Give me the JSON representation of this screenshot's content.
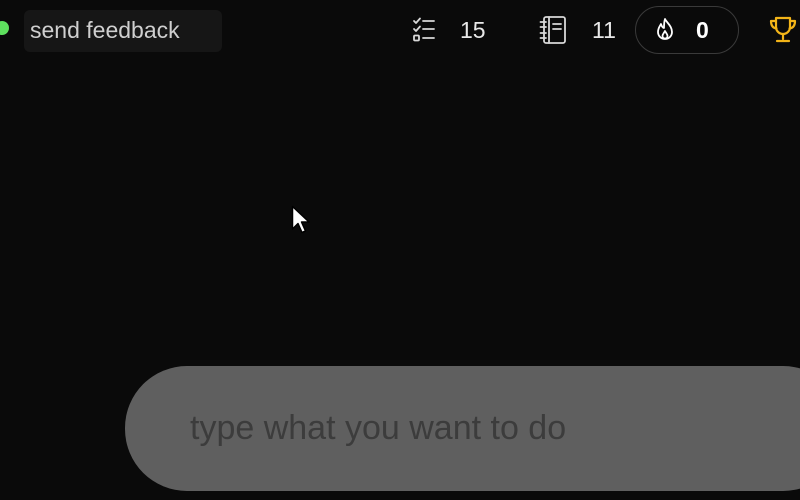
{
  "header": {
    "status_color": "#5ee05e",
    "feedback_label": "send feedback",
    "tasks": {
      "icon": "checklist-icon",
      "count": "15"
    },
    "notes": {
      "icon": "notebook-icon",
      "count": "11"
    },
    "streak": {
      "icon": "flame-icon",
      "count": "0"
    },
    "trophy": {
      "icon": "trophy-icon",
      "color": "#f2b418"
    }
  },
  "command": {
    "placeholder": "type what you want to do",
    "value": ""
  }
}
